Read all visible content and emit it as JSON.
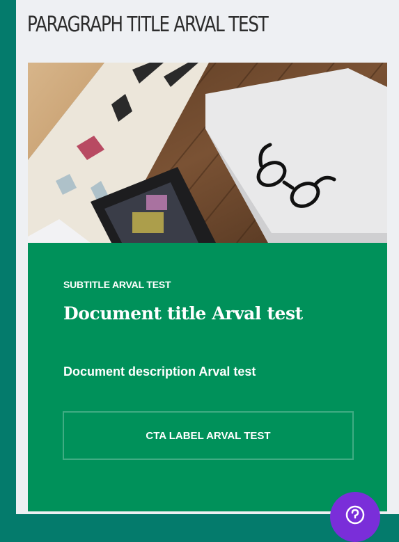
{
  "page": {
    "paragraph_title": "PARAGRAPH TITLE ARVAL TEST"
  },
  "card": {
    "image_alt": "Desk with laptop, notebook and glasses",
    "subtitle": "SUBTITLE ARVAL TEST",
    "title": "Document title Arval test",
    "description": "Document description Arval test",
    "cta_label": "CTA LABEL ARVAL TEST"
  },
  "help_button": {
    "icon": "question-circle-icon"
  },
  "colors": {
    "background": "#047b6c",
    "panel": "#eef0f3",
    "card": "#00915a",
    "fab": "#7a2ed9"
  }
}
